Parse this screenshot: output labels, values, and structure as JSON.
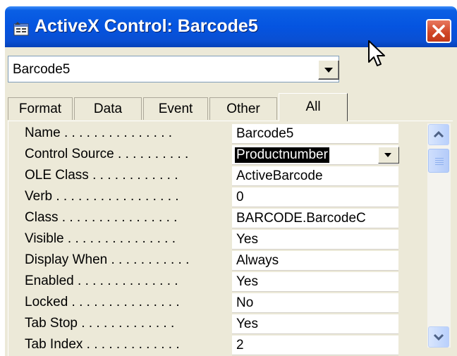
{
  "window": {
    "title": "ActiveX Control: Barcode5",
    "icon": "properties-window-icon",
    "close_icon": "close-icon"
  },
  "object_selector": {
    "value": "Barcode5"
  },
  "tabs": [
    {
      "label": "Format",
      "active": false
    },
    {
      "label": "Data",
      "active": false
    },
    {
      "label": "Event",
      "active": false
    },
    {
      "label": "Other",
      "active": false
    },
    {
      "label": "All",
      "active": true
    }
  ],
  "properties": [
    {
      "label": "Name . . . . . . . . . . . . . . .",
      "value": "Barcode5"
    },
    {
      "label": "Control Source . . . . . . . . . .",
      "value": "Productnumber",
      "selected": true
    },
    {
      "label": "OLE Class . . . . . . . . . . . .",
      "value": "ActiveBarcode"
    },
    {
      "label": "Verb . . . . . . . . . . . . . . . . .",
      "value": "0"
    },
    {
      "label": "Class . . . . . . . . . . . . . . . .",
      "value": "BARCODE.BarcodeC"
    },
    {
      "label": "Visible . . . . . . . . . . . . . . .",
      "value": "Yes"
    },
    {
      "label": "Display When . . . . . . . . . . .",
      "value": "Always"
    },
    {
      "label": "Enabled . . . . . . . . . . . . . .",
      "value": "Yes"
    },
    {
      "label": "Locked . . . . . . . . . . . . . . .",
      "value": "No"
    },
    {
      "label": "Tab Stop . . . . . . . . . . . . .",
      "value": "Yes"
    },
    {
      "label": "Tab Index . . . . . . . . . . . . .",
      "value": "2"
    }
  ],
  "colors": {
    "titlebar": "#0554e0",
    "face": "#ece9d8",
    "close": "#cf4525",
    "scroll": "#b9d0fc"
  }
}
